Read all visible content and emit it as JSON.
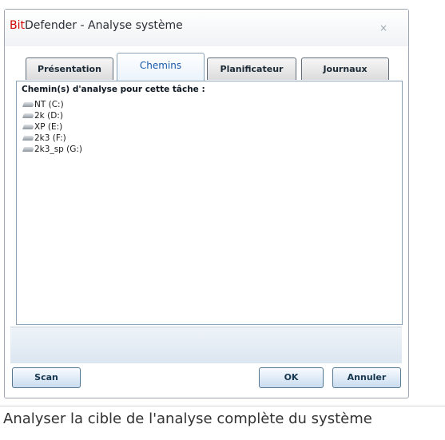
{
  "window": {
    "title_brand": "Bit",
    "title_rest": "Defender - Analyse système",
    "close_glyph": "×"
  },
  "tabs": [
    {
      "label": "Présentation",
      "active": false
    },
    {
      "label": "Chemins",
      "active": true
    },
    {
      "label": "Planificateur",
      "active": false
    },
    {
      "label": "Journaux",
      "active": false
    }
  ],
  "panel": {
    "section_title": "Chemin(s) d'analyse pour cette tâche :",
    "paths": [
      {
        "label": "NT (C:)",
        "icon": "drive-icon"
      },
      {
        "label": "2k (D:)",
        "icon": "drive-icon"
      },
      {
        "label": "XP (E:)",
        "icon": "drive-icon"
      },
      {
        "label": "2k3 (F:)",
        "icon": "drive-icon"
      },
      {
        "label": "2k3_sp (G:)",
        "icon": "drive-icon"
      }
    ]
  },
  "buttons": {
    "scan": "Scan",
    "ok": "OK",
    "cancel": "Annuler"
  },
  "caption": "Analyser la cible de l'analyse complète du système",
  "colors": {
    "brand_red": "#d10000",
    "active_tab_text": "#1a5aa8"
  }
}
